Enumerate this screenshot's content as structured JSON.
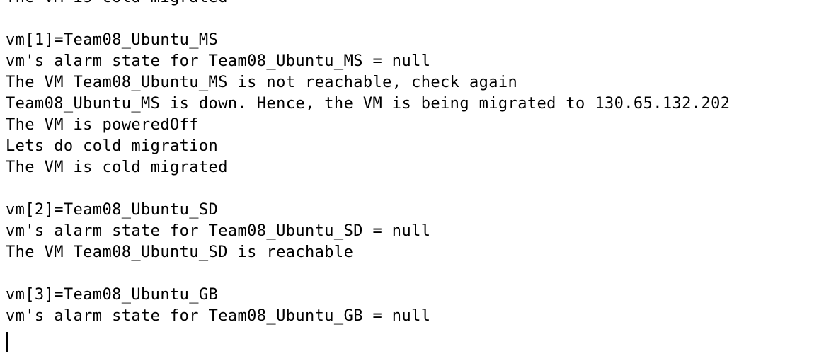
{
  "terminal": {
    "lines": [
      "The VM is cold migrated",
      "",
      "vm[1]=Team08_Ubuntu_MS",
      "vm's alarm state for Team08_Ubuntu_MS = null",
      "The VM Team08_Ubuntu_MS is not reachable, check again",
      "Team08_Ubuntu_MS is down. Hence, the VM is being migrated to 130.65.132.202",
      "The VM is poweredOff",
      "Lets do cold migration",
      "The VM is cold migrated",
      "",
      "vm[2]=Team08_Ubuntu_SD",
      "vm's alarm state for Team08_Ubuntu_SD = null",
      "The VM Team08_Ubuntu_SD is reachable",
      "",
      "vm[3]=Team08_Ubuntu_GB",
      "vm's alarm state for Team08_Ubuntu_GB = null"
    ],
    "colors": {
      "background": "#ffffff",
      "text": "#000000"
    }
  }
}
